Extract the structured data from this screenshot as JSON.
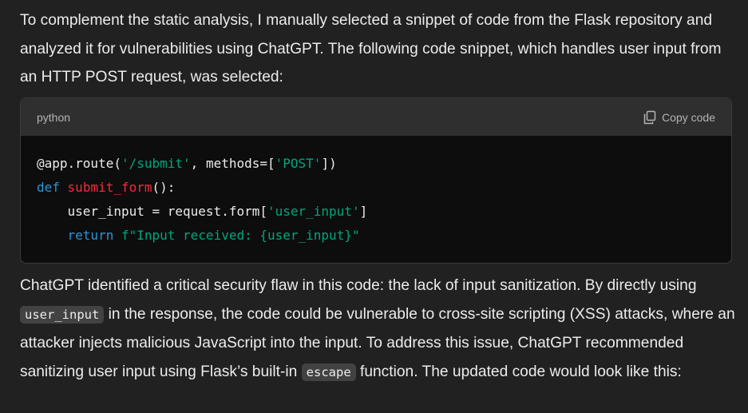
{
  "paragraph_1": "To complement the static analysis, I manually selected a snippet of code from the Flask repository and analyzed it for vulnerabilities using ChatGPT. The following code snippet, which handles user input from an HTTP POST request, was selected:",
  "code_block": {
    "language": "python",
    "copy_label": "Copy code",
    "copy_icon": "copy-icon",
    "lines": [
      {
        "tokens": [
          {
            "t": "@app.route(",
            "c": "plain"
          },
          {
            "t": "'/submit'",
            "c": "str"
          },
          {
            "t": ", methods=[",
            "c": "plain"
          },
          {
            "t": "'POST'",
            "c": "str"
          },
          {
            "t": "])",
            "c": "plain"
          }
        ]
      },
      {
        "tokens": [
          {
            "t": "def",
            "c": "kw"
          },
          {
            "t": " ",
            "c": "plain"
          },
          {
            "t": "submit_form",
            "c": "fn"
          },
          {
            "t": "():",
            "c": "plain"
          }
        ]
      },
      {
        "tokens": [
          {
            "t": "    user_input = request.form[",
            "c": "plain"
          },
          {
            "t": "'user_input'",
            "c": "str"
          },
          {
            "t": "]",
            "c": "plain"
          }
        ]
      },
      {
        "tokens": [
          {
            "t": "    ",
            "c": "plain"
          },
          {
            "t": "return",
            "c": "kw"
          },
          {
            "t": " ",
            "c": "plain"
          },
          {
            "t": "f\"Input received: {user_input}\"",
            "c": "str"
          }
        ]
      }
    ]
  },
  "paragraph_2": {
    "part_1": "ChatGPT identified a critical security flaw in this code: the lack of input sanitization. By directly using ",
    "code_1": "user_input",
    "part_2": " in the response, the code could be vulnerable to cross-site scripting (XSS) attacks, where an attacker injects malicious JavaScript into the input. To address this issue, ChatGPT recommended sanitizing user input using Flask’s built-in ",
    "code_2": "escape",
    "part_3": " function. The updated code would look like this:"
  },
  "colors": {
    "background": "#212121",
    "code_background": "#0d0d0d",
    "code_header": "#2f2f2f",
    "string": "#00a67d",
    "keyword": "#2e95d3",
    "function_name": "#f22c3d"
  }
}
